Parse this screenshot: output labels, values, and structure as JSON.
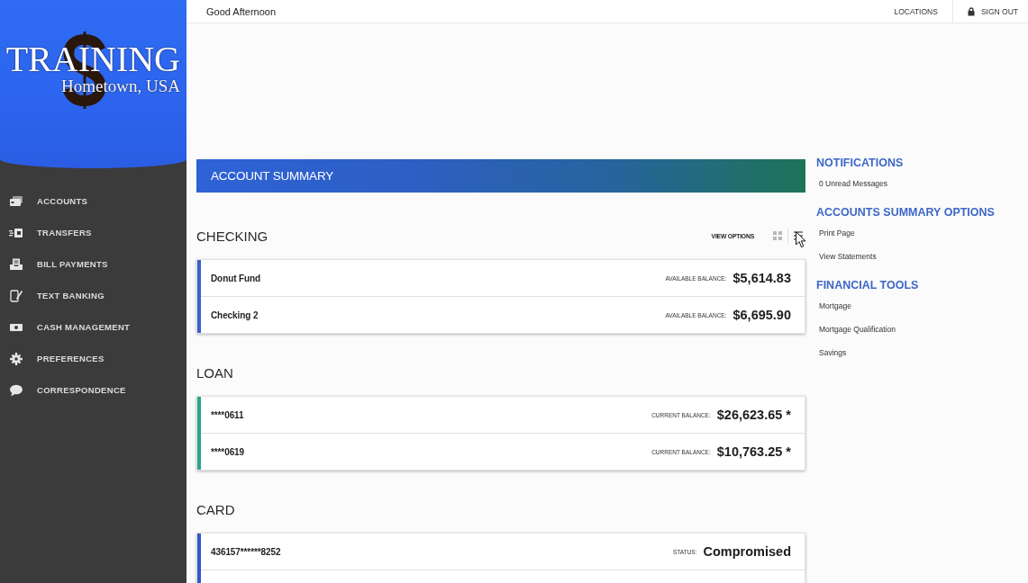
{
  "logo": {
    "title": "TRAINING",
    "subtitle": "Hometown, USA"
  },
  "sidebar": {
    "items": [
      {
        "label": "ACCOUNTS"
      },
      {
        "label": "TRANSFERS"
      },
      {
        "label": "BILL PAYMENTS"
      },
      {
        "label": "TEXT BANKING"
      },
      {
        "label": "CASH MANAGEMENT"
      },
      {
        "label": "PREFERENCES"
      },
      {
        "label": "CORRESPONDENCE"
      }
    ]
  },
  "top_bar": {
    "greeting": "Good Afternoon",
    "links": [
      {
        "label": "LOCATIONS",
        "kind": "text"
      },
      {
        "label": "SIGN OUT",
        "kind": "lock"
      }
    ]
  },
  "banner": {
    "title": "ACCOUNT SUMMARY"
  },
  "sections": [
    {
      "title": "CHECKING",
      "color": "#3a5fcd",
      "view_options": {
        "label": "VIEW OPTIONS"
      },
      "rows": [
        {
          "name": "Donut Fund",
          "label": "AVAILABLE BALANCE:",
          "value": "$5,614.83"
        },
        {
          "name": "Checking 2",
          "label": "AVAILABLE BALANCE:",
          "value": "$6,695.90"
        }
      ]
    },
    {
      "title": "LOAN",
      "color": "#2ca58d",
      "rows": [
        {
          "name": "****0611",
          "label": "CURRENT BALANCE:",
          "value": "$26,623.65 *"
        },
        {
          "name": "****0619",
          "label": "CURRENT BALANCE:",
          "value": "$10,763.25 *"
        }
      ]
    },
    {
      "title": "CARD",
      "color": "#3558c8",
      "rows": [
        {
          "name": "436157******8252",
          "label": "STATUS:",
          "value": "Compromised"
        }
      ]
    }
  ],
  "side_panels": [
    {
      "title": "NOTIFICATIONS",
      "links": [
        "0 Unread Messages"
      ]
    },
    {
      "title": "ACCOUNTS SUMMARY OPTIONS",
      "links": [
        "Print Page",
        "View Statements"
      ]
    },
    {
      "title": "FINANCIAL TOOLS",
      "links": [
        "Mortgage",
        "Mortgage Qualification",
        "Savings"
      ]
    }
  ]
}
